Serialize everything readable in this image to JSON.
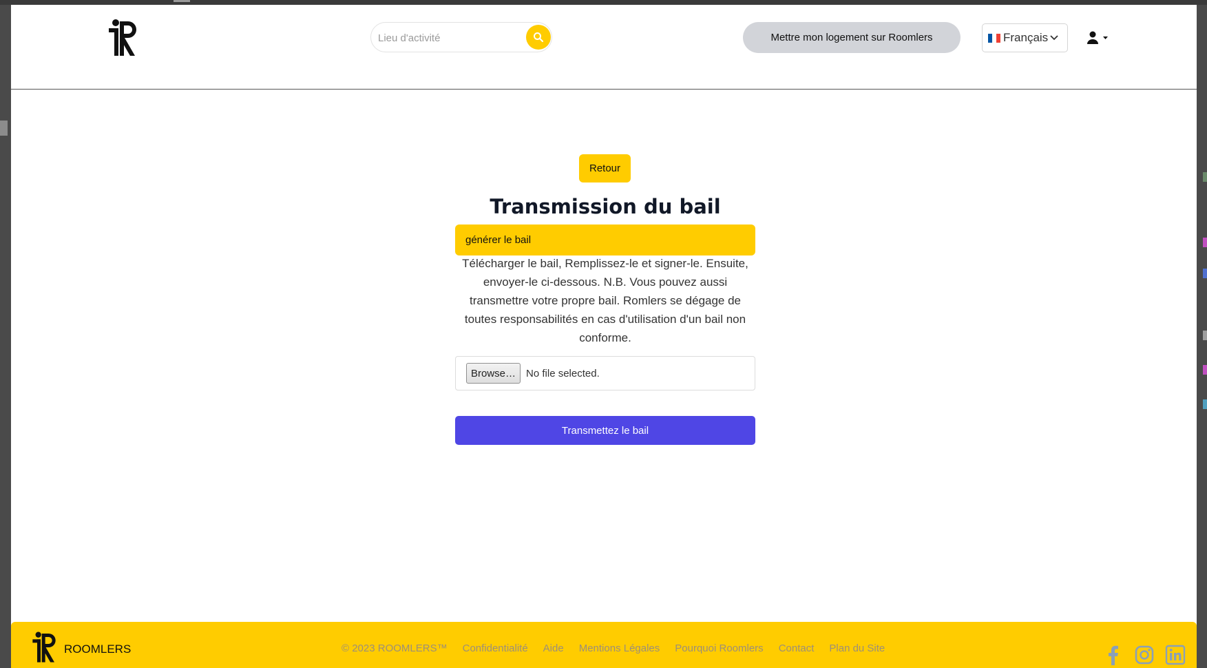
{
  "header": {
    "search_placeholder": "Lieu d'activité",
    "host_button": "Mettre mon logement sur Roomlers",
    "language": "Français"
  },
  "main": {
    "back_button": "Retour",
    "title": "Transmission du bail",
    "generate_button": "générer le bail",
    "description": "Télécharger le bail, Remplissez-le et signer-le. Ensuite, envoyer-le ci-dessous. N.B. Vous pouvez aussi transmettre votre propre bail. Romlers se dégage de toutes responsabilités en cas d'utilisation d'un bail non conforme.",
    "browse_button": "Browse…",
    "file_status": "No file selected.",
    "submit_button": "Transmettez le bail"
  },
  "footer": {
    "brand": "ROOMLERS",
    "links": [
      "© 2023 ROOMLERS™",
      "Confidentialité",
      "Aide",
      "Mentions Légales",
      "Pourquoi Roomlers",
      "Contact",
      "Plan du Site"
    ],
    "social_icons": [
      "facebook-icon",
      "instagram-icon",
      "linkedin-icon"
    ]
  },
  "colors": {
    "accent_yellow": "#ffcc00",
    "submit_blue": "#4f46e5",
    "host_button_gray": "#d2d4d9"
  }
}
